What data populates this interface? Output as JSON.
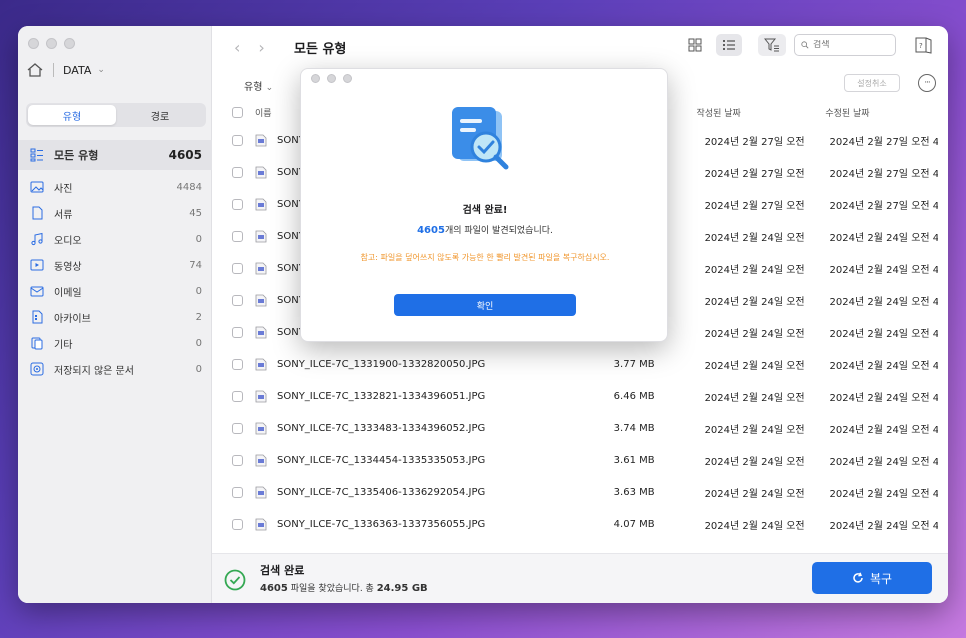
{
  "sidebar": {
    "drive_label": "DATA",
    "tabs": [
      {
        "label": "유형",
        "active": true
      },
      {
        "label": "경로",
        "active": false
      }
    ],
    "all": {
      "label": "모든 유형",
      "count": "4605"
    },
    "items": [
      {
        "label": "사진",
        "count": "4484",
        "icon": "photo-icon"
      },
      {
        "label": "서류",
        "count": "45",
        "icon": "document-icon"
      },
      {
        "label": "오디오",
        "count": "0",
        "icon": "audio-icon"
      },
      {
        "label": "동영상",
        "count": "74",
        "icon": "video-icon"
      },
      {
        "label": "이메일",
        "count": "0",
        "icon": "email-icon"
      },
      {
        "label": "아카이브",
        "count": "2",
        "icon": "archive-icon"
      },
      {
        "label": "기타",
        "count": "0",
        "icon": "other-icon"
      },
      {
        "label": "저장되지 않은 문서",
        "count": "0",
        "icon": "unsaved-doc-icon"
      }
    ]
  },
  "toolbar": {
    "title": "모든 유형",
    "search_placeholder": "검색",
    "type_filter": "유형",
    "reset_label": "설정취소"
  },
  "table": {
    "columns": {
      "name": "이름",
      "created": "작성된 날짜",
      "modified": "수정된 날짜"
    },
    "rows": [
      {
        "name": "SONY",
        "size": "",
        "created": "2024년 2월 27일 오전 4...",
        "modified": "2024년 2월 27일 오전 4..."
      },
      {
        "name": "SONY",
        "size": "",
        "created": "2024년 2월 27일 오전 4...",
        "modified": "2024년 2월 27일 오전 4..."
      },
      {
        "name": "SONY",
        "size": "",
        "created": "2024년 2월 27일 오전 4...",
        "modified": "2024년 2월 27일 오전 4..."
      },
      {
        "name": "SONY",
        "size": "",
        "created": "2024년 2월 24일 오전 4...",
        "modified": "2024년 2월 24일 오전 4..."
      },
      {
        "name": "SONY",
        "size": "",
        "created": "2024년 2월 24일 오전 4...",
        "modified": "2024년 2월 24일 오전 4..."
      },
      {
        "name": "SONY",
        "size": "",
        "created": "2024년 2월 24일 오전 4...",
        "modified": "2024년 2월 24일 오전 4..."
      },
      {
        "name": "SONY",
        "size": "",
        "created": "2024년 2월 24일 오전 4...",
        "modified": "2024년 2월 24일 오전 4..."
      },
      {
        "name": "SONY_ILCE-7C_1331900-1332820050.JPG",
        "size": "3.77 MB",
        "created": "2024년 2월 24일 오전 4...",
        "modified": "2024년 2월 24일 오전 4..."
      },
      {
        "name": "SONY_ILCE-7C_1332821-1334396051.JPG",
        "size": "6.46 MB",
        "created": "2024년 2월 24일 오전 4...",
        "modified": "2024년 2월 24일 오전 4..."
      },
      {
        "name": "SONY_ILCE-7C_1333483-1334396052.JPG",
        "size": "3.74 MB",
        "created": "2024년 2월 24일 오전 4...",
        "modified": "2024년 2월 24일 오전 4..."
      },
      {
        "name": "SONY_ILCE-7C_1334454-1335335053.JPG",
        "size": "3.61 MB",
        "created": "2024년 2월 24일 오전 4...",
        "modified": "2024년 2월 24일 오전 4..."
      },
      {
        "name": "SONY_ILCE-7C_1335406-1336292054.JPG",
        "size": "3.63 MB",
        "created": "2024년 2월 24일 오전 4...",
        "modified": "2024년 2월 24일 오전 4..."
      },
      {
        "name": "SONY_ILCE-7C_1336363-1337356055.JPG",
        "size": "4.07 MB",
        "created": "2024년 2월 24일 오전 4...",
        "modified": "2024년 2월 24일 오전 4..."
      }
    ]
  },
  "bottom": {
    "title": "검색 완료",
    "count": "4605",
    "found_text": "파일을 찾았습니다. 총",
    "total_size": "24.95 GB",
    "recover_label": "복구"
  },
  "modal": {
    "title": "검색 완료!",
    "count": "4605",
    "message": "개의 파일이 발견되었습니다.",
    "note": "참고: 파일을 덮어쓰지 않도록 가능한 한 빨리 발견된 파일을 복구하십시오.",
    "confirm_label": "확인"
  },
  "colors": {
    "accent": "#1f6fe6",
    "warning": "#f0962c",
    "success": "#34a853"
  }
}
